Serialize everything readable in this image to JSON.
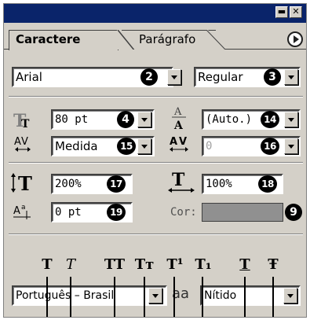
{
  "window": {
    "minimize_glyph": "▬",
    "close_glyph": "✕"
  },
  "tabs": [
    {
      "label": "Caractere",
      "active": true
    },
    {
      "label": "Parágrafo",
      "active": false
    }
  ],
  "font": {
    "family": "Arial",
    "family_badge": "2",
    "style": "Regular",
    "style_badge": "3"
  },
  "size": {
    "value": "80 pt",
    "badge": "4",
    "icon": "font-size-icon"
  },
  "leading": {
    "value": "(Auto.)",
    "badge": "14",
    "icon": "leading-icon"
  },
  "kerning": {
    "value": "Medida",
    "badge": "15",
    "icon": "kerning-icon"
  },
  "tracking": {
    "value": "0",
    "badge": "16",
    "icon": "tracking-icon"
  },
  "vertical_scale": {
    "value": "200%",
    "badge": "17",
    "icon": "vertical-scale-icon"
  },
  "horizontal_scale": {
    "value": "100%",
    "badge": "18",
    "icon": "horizontal-scale-icon"
  },
  "baseline_shift": {
    "value": "0 pt",
    "badge": "19",
    "icon": "baseline-shift-icon"
  },
  "color": {
    "label": "Cor:",
    "swatch": "#909090",
    "badge": "9"
  },
  "style_buttons": [
    {
      "glyph": "T",
      "name": "faux-bold"
    },
    {
      "glyph": "T",
      "name": "faux-italic"
    },
    {
      "glyph": "TT",
      "name": "all-caps"
    },
    {
      "glyph": "Tт",
      "name": "small-caps"
    },
    {
      "glyph": "T¹",
      "name": "superscript"
    },
    {
      "glyph": "T₁",
      "name": "subscript"
    },
    {
      "glyph": "T",
      "name": "underline"
    },
    {
      "glyph": "Ŧ",
      "name": "strikethrough"
    }
  ],
  "language": {
    "value": "Português – Brasil"
  },
  "antialias": {
    "icon_glyph": "aa",
    "value": "Nítido"
  },
  "colors": {
    "title_bar": "#0a246a",
    "panel": "#d4d0c8"
  }
}
